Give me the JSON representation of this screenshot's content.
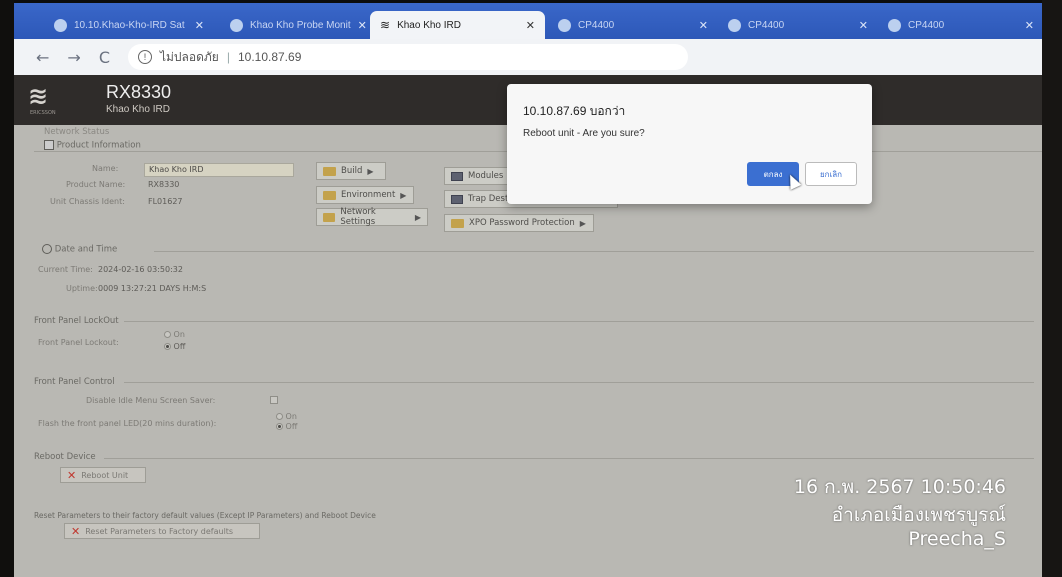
{
  "browser": {
    "tabs": [
      {
        "label": "10.10.Khao-Kho-IRD Sat",
        "active": false
      },
      {
        "label": "Khao Kho Probe Monit",
        "active": false
      },
      {
        "label": "Khao Kho IRD",
        "active": true
      },
      {
        "label": "CP4400",
        "active": false
      },
      {
        "label": "CP4400",
        "active": false
      },
      {
        "label": "CP4400",
        "active": false
      }
    ],
    "security_text": "ไม่ปลอดภัย",
    "url": "10.10.87.69"
  },
  "app": {
    "brand": "ERICSSON",
    "model": "RX8330",
    "site_name": "Khao Kho IRD",
    "nav_label": "Network Status"
  },
  "product_info": {
    "section_title": "Product Information",
    "name_label": "Name:",
    "name_value": "Khao Kho IRD",
    "product_name_label": "Product Name:",
    "product_name_value": "RX8330",
    "chassis_label": "Unit Chassis Ident:",
    "chassis_value": "FL01627"
  },
  "menus": {
    "build": "Build",
    "environment": "Environment",
    "network_settings": "Network Settings",
    "modules": "Modules",
    "trap_table": "Trap Destination Table [0]",
    "xpo_password": "XPO Password Protection"
  },
  "date_time": {
    "section_title": "Date and Time",
    "current_time_label": "Current Time:",
    "current_time_value": "2024-02-16 03:50:32",
    "uptime_label": "Uptime:",
    "uptime_value": "0009 13:27:21 DAYS H:M:S"
  },
  "lockout": {
    "section_title": "Front Panel LockOut",
    "label": "Front Panel Lockout:",
    "on": "On",
    "off": "Off"
  },
  "panel_control": {
    "section_title": "Front Panel Control",
    "screen_saver_label": "Disable Idle Menu Screen Saver:",
    "flash_label": "Flash the front panel LED(20 mins duration):",
    "on": "On",
    "off": "Off"
  },
  "reboot": {
    "section_title": "Reboot Device",
    "button": "Reboot Unit"
  },
  "factory_reset": {
    "section_title": "Reset Parameters to their factory default values (Except IP Parameters) and Reboot Device",
    "button": "Reset Parameters to Factory defaults"
  },
  "dialog": {
    "title": "10.10.87.69 บอกว่า",
    "message": "Reboot unit - Are you sure?",
    "ok": "ตกลง",
    "cancel": "ยกเลิก"
  },
  "overlay": {
    "datetime": "16 ก.พ. 2567 10:50:46",
    "location": "อำเภอเมืองเพชรบูรณ์",
    "user": "Preecha_S"
  }
}
